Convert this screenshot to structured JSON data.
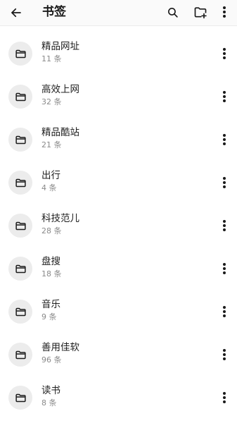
{
  "header": {
    "title": "书签",
    "back_icon": "arrow-left-icon",
    "search_icon": "search-icon",
    "add_folder_icon": "folder-plus-icon",
    "more_icon": "more-vertical-icon"
  },
  "colors": {
    "background": "#ffffff",
    "appbar": "#fafafa",
    "avatar_bg": "#ececec",
    "text_primary": "#1f1f1f",
    "text_secondary": "#8a8a8a"
  },
  "folders": [
    {
      "name": "精品网址",
      "count": "11 条"
    },
    {
      "name": "高效上网",
      "count": "32 条"
    },
    {
      "name": "精品酷站",
      "count": "21 条"
    },
    {
      "name": "出行",
      "count": "4 条"
    },
    {
      "name": "科技范儿",
      "count": "28 条"
    },
    {
      "name": "盘搜",
      "count": "18 条"
    },
    {
      "name": "音乐",
      "count": "9 条"
    },
    {
      "name": "善用佳软",
      "count": "96 条"
    },
    {
      "name": "读书",
      "count": "8 条"
    }
  ]
}
